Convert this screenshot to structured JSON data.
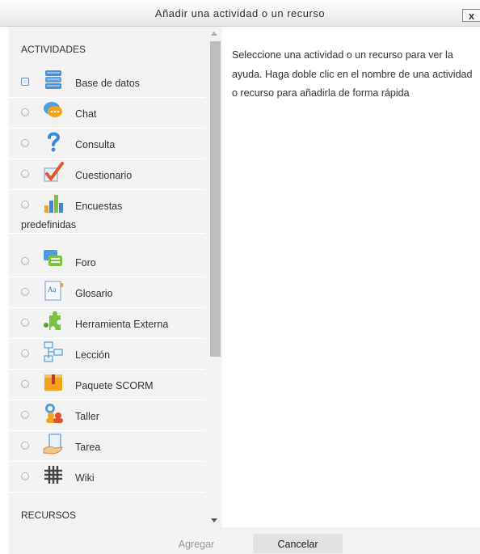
{
  "dialog": {
    "title": "Añadir una actividad o un recurso",
    "close": "x"
  },
  "activities": {
    "heading": "ACTIVIDADES",
    "items": [
      {
        "label": "Base de datos",
        "icon": "database-icon",
        "checked": true
      },
      {
        "label": "Chat",
        "icon": "chat-bubble-icon"
      },
      {
        "label": "Consulta",
        "icon": "question-mark-icon"
      },
      {
        "label": "Cuestionario",
        "icon": "checkmark-icon"
      },
      {
        "label": "Encuestas",
        "label_cont": "predefinidas",
        "icon": "bar-chart-icon"
      },
      {
        "label": "Foro",
        "icon": "forum-icon"
      },
      {
        "label": "Glosario",
        "icon": "glossary-icon"
      },
      {
        "label": "Herramienta Externa",
        "icon": "puzzle-icon"
      },
      {
        "label": "Lección",
        "icon": "lesson-flow-icon"
      },
      {
        "label": "Paquete SCORM",
        "icon": "package-box-icon"
      },
      {
        "label": "Taller",
        "icon": "workshop-people-icon"
      },
      {
        "label": "Tarea",
        "icon": "hand-document-icon"
      },
      {
        "label": "Wiki",
        "icon": "wiki-icon"
      }
    ]
  },
  "resources": {
    "heading": "RECURSOS"
  },
  "help": {
    "text": "Seleccione una actividad o un recurso para ver la ayuda. Haga doble clic en el nombre de una actividad o recurso para añadirla de forma rápida"
  },
  "buttons": {
    "add": "Agregar",
    "cancel": "Cancelar"
  },
  "colors": {
    "panel": "#f2f2f2",
    "cancel_bg": "#e2e2e2",
    "disabled_text": "#999999"
  }
}
